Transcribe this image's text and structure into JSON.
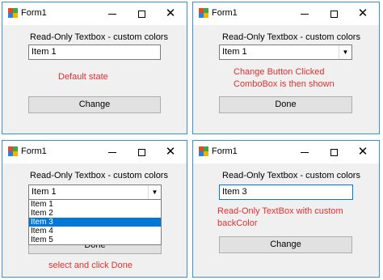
{
  "windows": [
    {
      "title": "Form1",
      "caption": "Read-Only Textbox - custom colors",
      "textbox_value": "Item 1",
      "note": "Default state",
      "button_label": "Change"
    },
    {
      "title": "Form1",
      "caption": "Read-Only Textbox - custom colors",
      "combo_value": "Item 1",
      "note": "Change Button Clicked\nComboBox is then shown",
      "button_label": "Done"
    },
    {
      "title": "Form1",
      "caption": "Read-Only Textbox - custom colors",
      "combo_value": "Item 1",
      "dropdown_items": [
        "Item 1",
        "Item 2",
        "Item 3",
        "Item 4",
        "Item 5"
      ],
      "selected_item": "Item 3",
      "button_label": "Done",
      "note": "select and click Done"
    },
    {
      "title": "Form1",
      "caption": "Read-Only Textbox - custom colors",
      "textbox_value": "Item 3",
      "note": "Read-Only TextBox with custom\nbackColor",
      "button_label": "Change"
    }
  ],
  "icons": {
    "minimize": "minimize-icon",
    "maximize": "maximize-icon",
    "close": "close-icon",
    "app": "form-app-icon",
    "dropdown_arrow": "chevron-down-icon"
  },
  "colors": {
    "window_border": "#3a8fd8",
    "note_text": "#e03030",
    "selection": "#0078d7"
  }
}
